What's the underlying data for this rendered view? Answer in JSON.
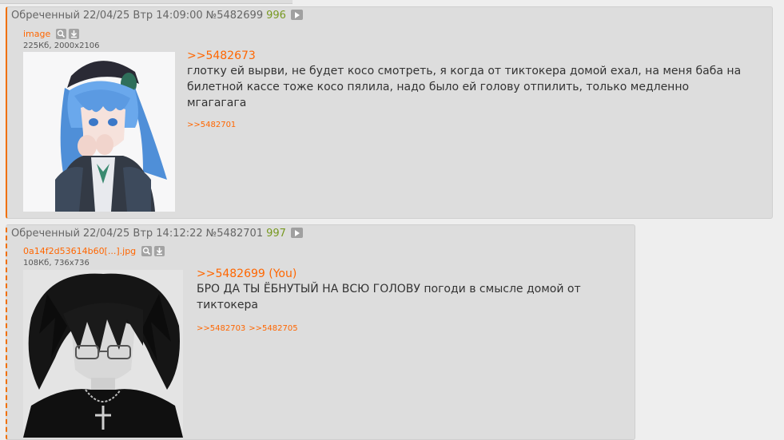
{
  "posts": [
    {
      "author": "Обреченный",
      "datetime": "22/04/25 Втр 14:09:00",
      "number": "№5482699",
      "count": "996",
      "file": {
        "name": "image",
        "meta": "225Кб, 2000x2106"
      },
      "reply_to": ">>5482673",
      "message": "глотку ей вырви, не будет косо смотреть, я когда от тиктокера домой ехал, на меня баба на билетной кассе тоже косо пялила, надо было ей голову отпилить, только медленно мгагагага",
      "replies": [
        ">>5482701"
      ]
    },
    {
      "author": "Обреченный",
      "datetime": "22/04/25 Втр 14:12:22",
      "number": "№5482701",
      "count": "997",
      "file": {
        "name": "0a14f2d53614b60[...].jpg",
        "meta": "108Кб, 736x736"
      },
      "reply_to": ">>5482699 (You)",
      "message": "БРО ДА ТЫ ЁБНУТЫЙ НА ВСЮ ГОЛОВУ погоди в смысле домой от тиктокера",
      "replies": [
        ">>5482703",
        ">>5482705"
      ]
    }
  ],
  "icons": [
    "play-icon",
    "search-icon",
    "download-icon"
  ],
  "colors": {
    "link": "#ff6600",
    "count": "#789922",
    "post_bg": "#dddddd",
    "page_bg": "#eeeeee",
    "accent_border": "#f07000"
  }
}
